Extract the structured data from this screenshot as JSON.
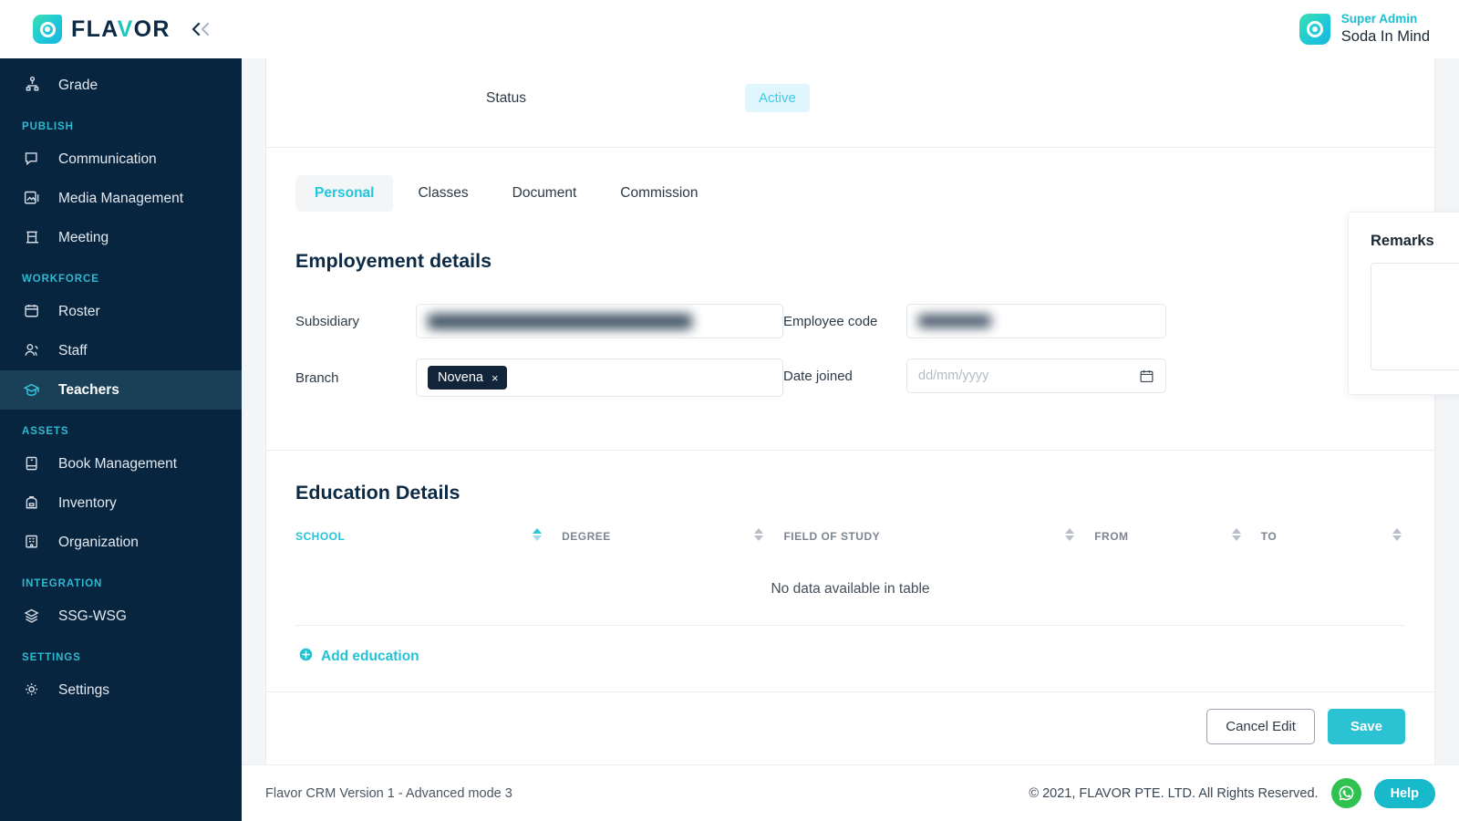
{
  "brand": {
    "name_prefix": "FLA",
    "name_v": "V",
    "name_suffix": "OR",
    "collapse_icon": "chevron-double-left-icon"
  },
  "topbar": {
    "role": "Super Admin",
    "account": "Soda In Mind"
  },
  "sidebar": {
    "items": [
      {
        "label": "Grade",
        "icon": "grade-icon",
        "type": "item",
        "active": false
      },
      {
        "label": "PUBLISH",
        "type": "group"
      },
      {
        "label": "Communication",
        "icon": "chat-icon",
        "type": "item",
        "active": false
      },
      {
        "label": "Media Management",
        "icon": "media-icon",
        "type": "item",
        "active": false
      },
      {
        "label": "Meeting",
        "icon": "podium-icon",
        "type": "item",
        "active": false
      },
      {
        "label": "WORKFORCE",
        "type": "group"
      },
      {
        "label": "Roster",
        "icon": "calendar-icon",
        "type": "item",
        "active": false
      },
      {
        "label": "Staff",
        "icon": "people-icon",
        "type": "item",
        "active": false
      },
      {
        "label": "Teachers",
        "icon": "graduation-cap-icon",
        "type": "item",
        "active": true
      },
      {
        "label": "ASSETS",
        "type": "group"
      },
      {
        "label": "Book Management",
        "icon": "book-icon",
        "type": "item",
        "active": false
      },
      {
        "label": "Inventory",
        "icon": "backpack-icon",
        "type": "item",
        "active": false
      },
      {
        "label": "Organization",
        "icon": "building-icon",
        "type": "item",
        "active": false
      },
      {
        "label": "INTEGRATION",
        "type": "group"
      },
      {
        "label": "SSG-WSG",
        "icon": "layers-icon",
        "type": "item",
        "active": false
      },
      {
        "label": "SETTINGS",
        "type": "group"
      },
      {
        "label": "Settings",
        "icon": "gear-icon",
        "type": "item",
        "active": false
      }
    ]
  },
  "status": {
    "label": "Status",
    "value": "Active",
    "badge_bg": "#dff6fd",
    "badge_color": "#3ecbe8"
  },
  "tabs": [
    {
      "label": "Personal",
      "active": true
    },
    {
      "label": "Classes",
      "active": false
    },
    {
      "label": "Document",
      "active": false
    },
    {
      "label": "Commission",
      "active": false
    }
  ],
  "employment": {
    "title": "Employement details",
    "subsidiary_label": "Subsidiary",
    "subsidiary_value": "",
    "branch_label": "Branch",
    "branch_chip": "Novena",
    "branch_chip_remove": "×",
    "employee_code_label": "Employee code",
    "employee_code_value": "",
    "date_joined_label": "Date joined",
    "date_joined_placeholder": "dd/mm/yyyy",
    "date_joined_value": "",
    "calendar_icon": "calendar-icon"
  },
  "remarks": {
    "title": "Remarks",
    "value": "",
    "placeholder": ""
  },
  "education": {
    "title": "Education Details",
    "columns": [
      {
        "label": "SCHOOL",
        "active": true,
        "sortable": true
      },
      {
        "label": "DEGREE",
        "active": false,
        "sortable": true
      },
      {
        "label": "FIELD OF STUDY",
        "active": false,
        "sortable": true
      },
      {
        "label": "FROM",
        "active": false,
        "sortable": true
      },
      {
        "label": "TO",
        "active": false,
        "sortable": true
      }
    ],
    "empty_text": "No data available in table",
    "add_label": "Add education",
    "add_icon": "plus-circle-icon"
  },
  "actions": {
    "cancel_label": "Cancel Edit",
    "save_label": "Save"
  },
  "footer": {
    "version": "Flavor CRM Version 1 - Advanced mode 3",
    "copyright": "© 2021, FLAVOR PTE. LTD. All Rights Reserved.",
    "whatsapp_icon": "whatsapp-icon",
    "help_label": "Help"
  },
  "colors": {
    "accent": "#22c3d7",
    "sidebar": "#082540",
    "sidebar_active": "#1a4058",
    "group_label": "#2fb9cf"
  }
}
